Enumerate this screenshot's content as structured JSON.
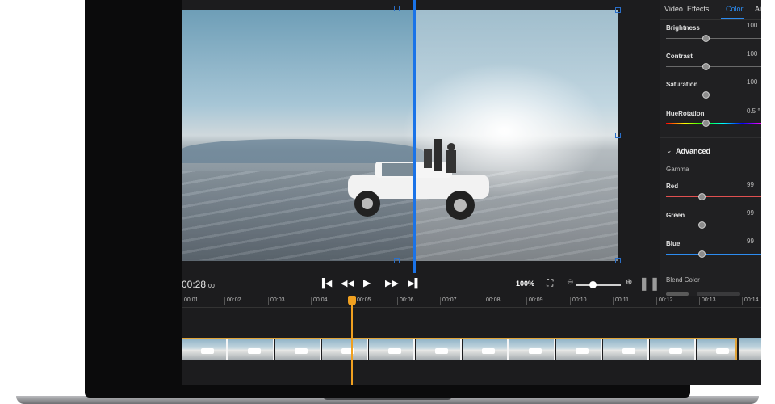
{
  "player": {
    "current_time": "00:28",
    "current_frame": "00",
    "zoom_percent": "100%"
  },
  "panel": {
    "tabs": [
      "Video",
      "Effects",
      "Color",
      "Ai"
    ],
    "active_tab": "Color",
    "sliders": {
      "brightness": {
        "label": "Brightness",
        "value": "100"
      },
      "contrast": {
        "label": "Contrast",
        "value": "100"
      },
      "saturation": {
        "label": "Saturation",
        "value": "100"
      },
      "hue_rotation": {
        "label": "HueRotation",
        "value": "0.5 °"
      }
    },
    "advanced": {
      "title": "Advanced",
      "gamma_label": "Gamma",
      "red": {
        "label": "Red",
        "value": "99"
      },
      "green": {
        "label": "Green",
        "value": "99"
      },
      "blue": {
        "label": "Blue",
        "value": "99"
      }
    },
    "blend_color_label": "Blend Color"
  },
  "timeline": {
    "ruler": [
      "00:01",
      "00:02",
      "00:03",
      "00:04",
      "00:05",
      "00:06",
      "00:07",
      "00:08",
      "00:09",
      "00:10",
      "00:11",
      "00:12",
      "00:13",
      "00:14"
    ]
  },
  "colors": {
    "accent": "#2d8cf0",
    "split_line": "#1a73e8",
    "playhead": "#f0a020",
    "red_track": "#e05050",
    "green_track": "#4caf50",
    "blue_track": "#2d8cf0"
  },
  "icons": [
    "skip-back-icon",
    "rewind-icon",
    "play-icon",
    "fast-forward-icon",
    "skip-forward-icon",
    "fullscreen-icon",
    "zoom-out-icon",
    "zoom-in-icon",
    "pause-icon",
    "chevron-down-icon"
  ]
}
